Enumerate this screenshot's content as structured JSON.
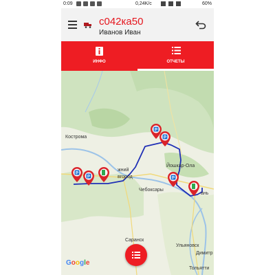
{
  "status_bar": {
    "time": "0:09",
    "network_speed": "0,24K/c",
    "battery": "60%"
  },
  "header": {
    "title": "с042ка50",
    "subtitle": "Иванов Иван",
    "menu_icon": "hamburger-icon",
    "vehicle_icon": "truck-icon",
    "back_icon": "back-arrow-icon"
  },
  "tabs": [
    {
      "label": "ИНФО",
      "icon": "info-icon",
      "active": false
    },
    {
      "label": "ОТЧЕТЫ",
      "icon": "list-icon",
      "active": true
    }
  ],
  "map": {
    "labels": {
      "kostroma": "Кострома",
      "nizhny": "жний",
      "novgorod": "вгород",
      "yoshkar_ola": "Йошкар-Ола",
      "cheboksary": "Чебоксары",
      "kazan": "ань",
      "saransk": "Саранск",
      "ulyanovsk": "Ульяновск",
      "dimitrovgrad": "Димитр",
      "tolyatti": "Тольятти"
    },
    "logo": "Google",
    "route_color": "#1f2fb5",
    "marker_color": "#d9232a"
  },
  "fab": {
    "icon": "report-list-icon"
  },
  "colors": {
    "accent": "#ee1d23",
    "title": "#e5151d"
  }
}
